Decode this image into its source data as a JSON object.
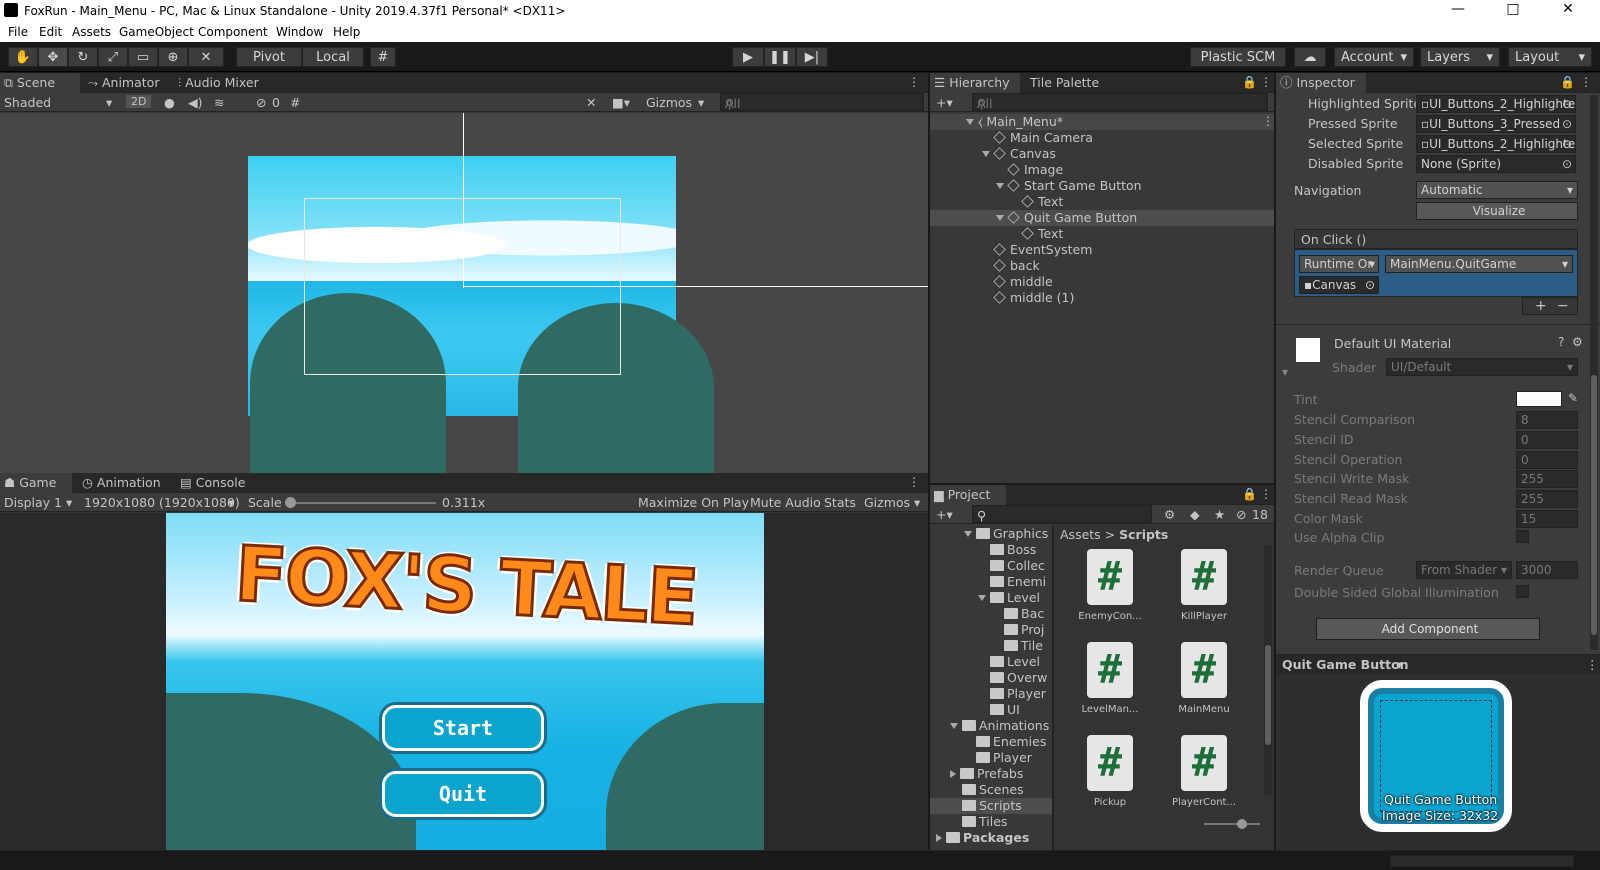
{
  "window": {
    "title": "FoxRun - Main_Menu - PC, Mac & Linux Standalone - Unity 2019.4.37f1 Personal* <DX11>",
    "minimize": "—",
    "maximize": "□",
    "close": "✕"
  },
  "menu": [
    "File",
    "Edit",
    "Assets",
    "GameObject",
    "Component",
    "Window",
    "Help"
  ],
  "toolbar": {
    "pivot": "Pivot",
    "local": "Local",
    "plastic": "Plastic SCM",
    "account": "Account",
    "layers": "Layers",
    "layout": "Layout"
  },
  "scene": {
    "tabs": [
      "Scene",
      "Animator",
      "Audio Mixer"
    ],
    "shading": "Shaded",
    "mode2d": "2D",
    "hidden_count": "0",
    "gizmos": "Gizmos",
    "search_placeholder": "All"
  },
  "game": {
    "tabs": [
      "Game",
      "Animation",
      "Console"
    ],
    "display": "Display 1",
    "resolution": "1920x1080 (1920x1080)",
    "scale_label": "Scale",
    "scale_value": "0.311x",
    "scale_fraction": 0.0,
    "maximize": "Maximize On Play",
    "mute": "Mute Audio",
    "stats": "Stats",
    "gizmos": "Gizmos",
    "logo": "FOX'S TALE",
    "start": "Start",
    "quit": "Quit"
  },
  "hierarchy": {
    "tabs": [
      "Hierarchy",
      "Tile Palette"
    ],
    "search_placeholder": "All",
    "items": [
      "Main_Menu*",
      "Main Camera",
      "Canvas",
      "Image",
      "Start Game Button",
      "Text",
      "Quit Game Button",
      "Text",
      "EventSystem",
      "back",
      "middle",
      "middle (1)"
    ]
  },
  "project": {
    "tab": "Project",
    "hidden_count": "18",
    "breadcrumb": [
      "Assets",
      "Scripts"
    ],
    "tree": [
      "Graphics",
      "Boss",
      "Collec",
      "Enemi",
      "Level",
      "Bac",
      "Proj",
      "Tile",
      "Level",
      "Overw",
      "Player",
      "UI",
      "Animations",
      "Enemies",
      "Player",
      "Prefabs",
      "Scenes",
      "Scripts",
      "Tiles",
      "Packages"
    ],
    "scripts": [
      "EnemyCon...",
      "KillPlayer",
      "LevelMan...",
      "MainMenu",
      "Pickup",
      "PlayerCont..."
    ],
    "glyph": "#"
  },
  "inspector": {
    "tab": "Inspector",
    "sprites": [
      {
        "label": "Highlighted Sprite",
        "value": "UI_Buttons_2_Highlighte"
      },
      {
        "label": "Pressed Sprite",
        "value": "UI_Buttons_3_Pressed"
      },
      {
        "label": "Selected Sprite",
        "value": "UI_Buttons_2_Highlighte"
      },
      {
        "label": "Disabled Sprite",
        "value": "None (Sprite)"
      }
    ],
    "navigation_label": "Navigation",
    "navigation_value": "Automatic",
    "visualize": "Visualize",
    "onclick": "On Click ()",
    "runtime": "Runtime Or",
    "function": "MainMenu.QuitGame",
    "target": "Canvas",
    "plus": "+",
    "minus": "−",
    "material": "Default UI Material",
    "shader_label": "Shader",
    "shader_value": "UI/Default",
    "props": [
      {
        "label": "Tint",
        "value": ""
      },
      {
        "label": "Stencil Comparison",
        "value": "8"
      },
      {
        "label": "Stencil ID",
        "value": "0"
      },
      {
        "label": "Stencil Operation",
        "value": "0"
      },
      {
        "label": "Stencil Write Mask",
        "value": "255"
      },
      {
        "label": "Stencil Read Mask",
        "value": "255"
      },
      {
        "label": "Color Mask",
        "value": "15"
      },
      {
        "label": "Use Alpha Clip",
        "value": ""
      }
    ],
    "render_queue_label": "Render Queue",
    "render_queue_mode": "From Shader",
    "render_queue_value": "3000",
    "double_sided": "Double Sided Global Illumination",
    "add_component": "Add Component",
    "preview_title": "Quit Game Button",
    "preview_name": "Quit Game Button",
    "preview_size": "Image Size: 32x32"
  },
  "colors": {
    "accent_blue": "#2c5d87",
    "sky": "#3dd0f0",
    "button": "#0aa4cf"
  }
}
